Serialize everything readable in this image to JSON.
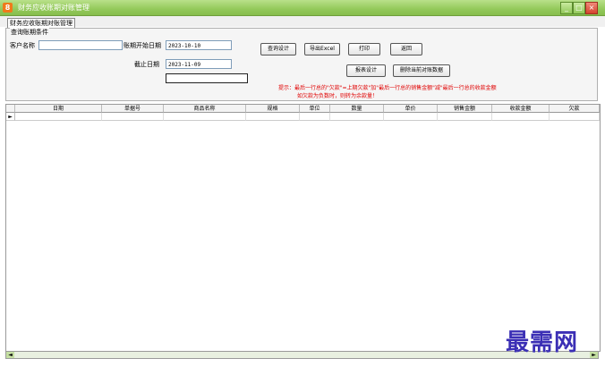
{
  "window": {
    "title": "财务应收账期对账管理",
    "minimize": "_",
    "maximize": "□",
    "close": "×"
  },
  "tab": {
    "label": "财务应收账期对账管理"
  },
  "query": {
    "legend": "查询账期条件",
    "customer_label": "客户名称",
    "customer_value": "",
    "start_label": "账期开始日期",
    "start_value": "2023-10-10",
    "end_label": "截止日期",
    "end_value": "2023-11-09",
    "extra_value": ""
  },
  "buttons": {
    "query_design": "查询设计",
    "export_excel": "导出Excel",
    "print": "打印",
    "back": "返回",
    "report_design": "报表设计",
    "delete_current": "删除当前对账数据"
  },
  "hint": {
    "line1": "提示：最后一行总的\"欠款\"=上期欠款\"加\"最后一行总的销售金额\"减\"最后一行总的收款金额",
    "line2": "如欠款为负数时，则转为余款量！"
  },
  "grid": {
    "columns": [
      "日期",
      "单据号",
      "商品名称",
      "规格",
      "单位",
      "数量",
      "单价",
      "销售金额",
      "收款金额",
      "欠款"
    ],
    "row_indicator": "►"
  },
  "scrollbar": {
    "left": "◄",
    "right": "►"
  },
  "watermark": "最需网"
}
